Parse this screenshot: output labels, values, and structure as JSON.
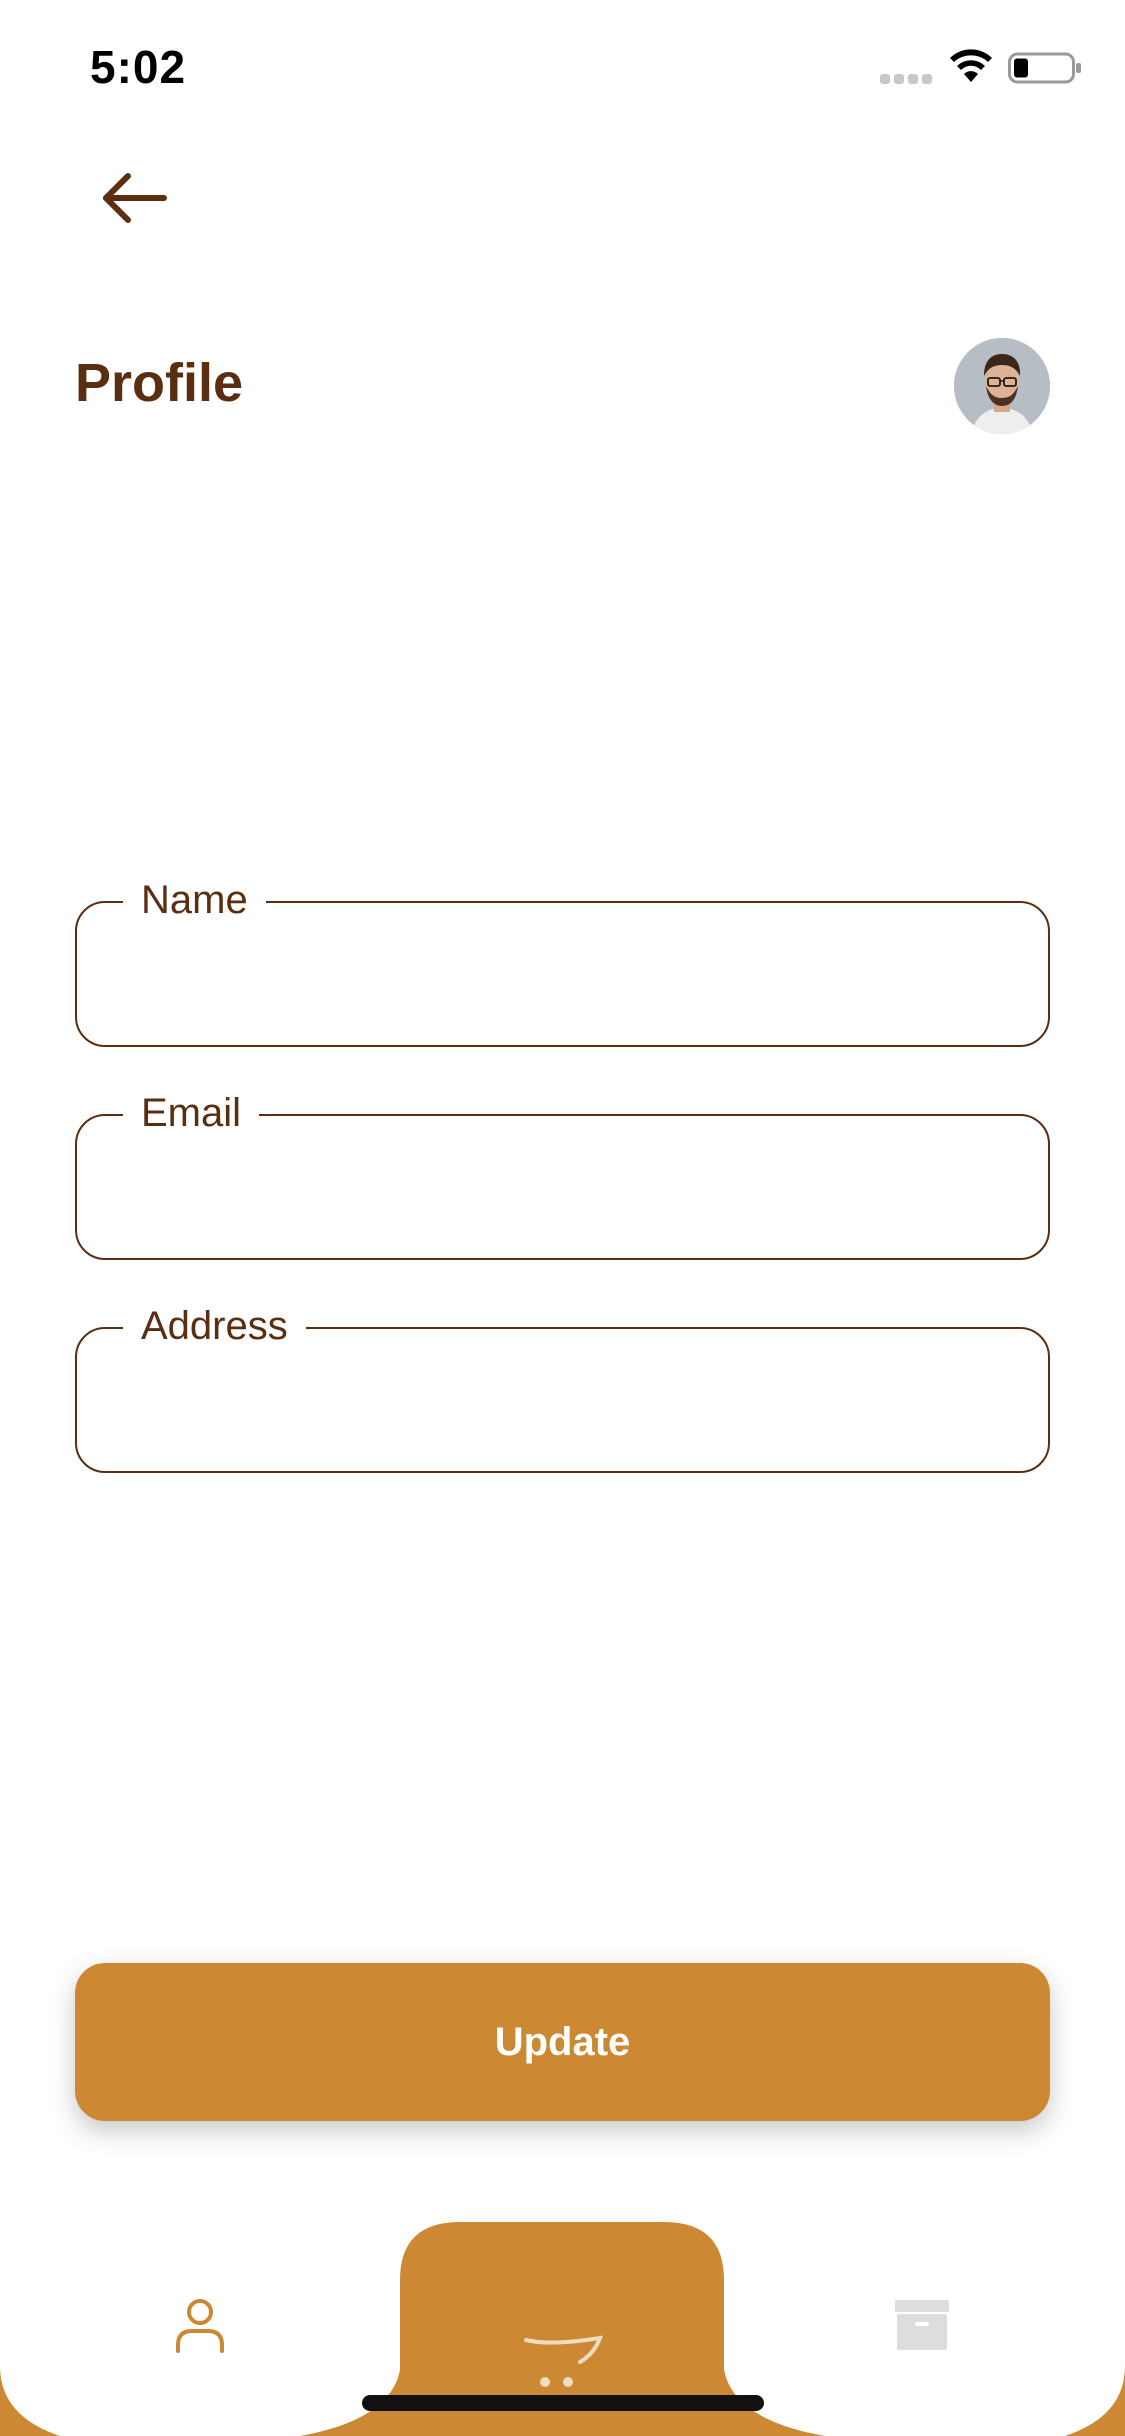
{
  "status_bar": {
    "time": "5:02"
  },
  "header": {
    "back_icon": "arrow-left-icon",
    "title": "Profile",
    "avatar": "user-avatar-photo"
  },
  "form": {
    "fields": [
      {
        "label": "Name",
        "value": "",
        "placeholder": ""
      },
      {
        "label": "Email",
        "value": "",
        "placeholder": ""
      },
      {
        "label": "Address",
        "value": "",
        "placeholder": ""
      }
    ]
  },
  "actions": {
    "update_label": "Update"
  },
  "bottom_nav": {
    "items": [
      {
        "icon": "user-icon"
      },
      {
        "icon": "cart-icon"
      },
      {
        "icon": "archive-box-icon"
      }
    ]
  },
  "colors": {
    "primary": "#cc8833",
    "text_dark": "#5a2e10",
    "background": "#ffffff"
  }
}
